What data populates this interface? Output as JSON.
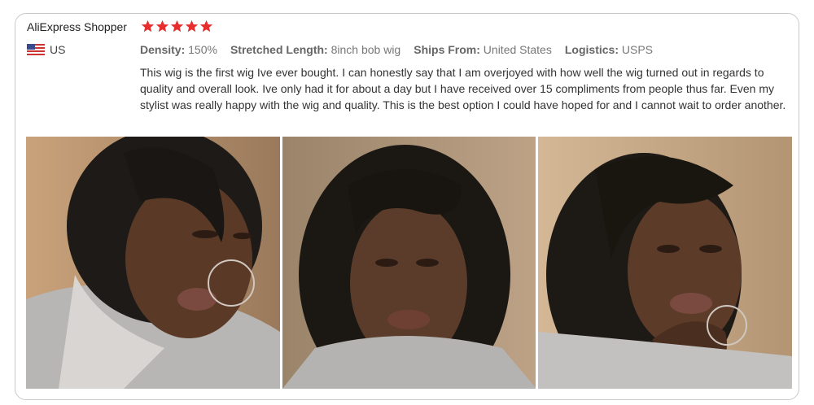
{
  "review": {
    "author": "AliExpress Shopper",
    "rating": 5,
    "country": "US",
    "star_color": "#e62e2e",
    "attributes": [
      {
        "key": "Density:",
        "value": "150%"
      },
      {
        "key": "Stretched Length:",
        "value": "8inch bob wig"
      },
      {
        "key": "Ships From:",
        "value": "United States"
      },
      {
        "key": "Logistics:",
        "value": "USPS"
      }
    ],
    "text": "This wig is the first wig Ive ever bought. I can honestly say that I am overjoyed with how well the wig turned out in regards to quality and overall look. Ive only had it for about a day but I have received over 15 compliments from people thus far. Even my stylist was really happy with the wig and quality. This is the best option I could have hoped for and I cannot wait to order another."
  },
  "photos": [
    {
      "icon": "review-photo-1"
    },
    {
      "icon": "review-photo-2"
    },
    {
      "icon": "review-photo-3"
    }
  ]
}
